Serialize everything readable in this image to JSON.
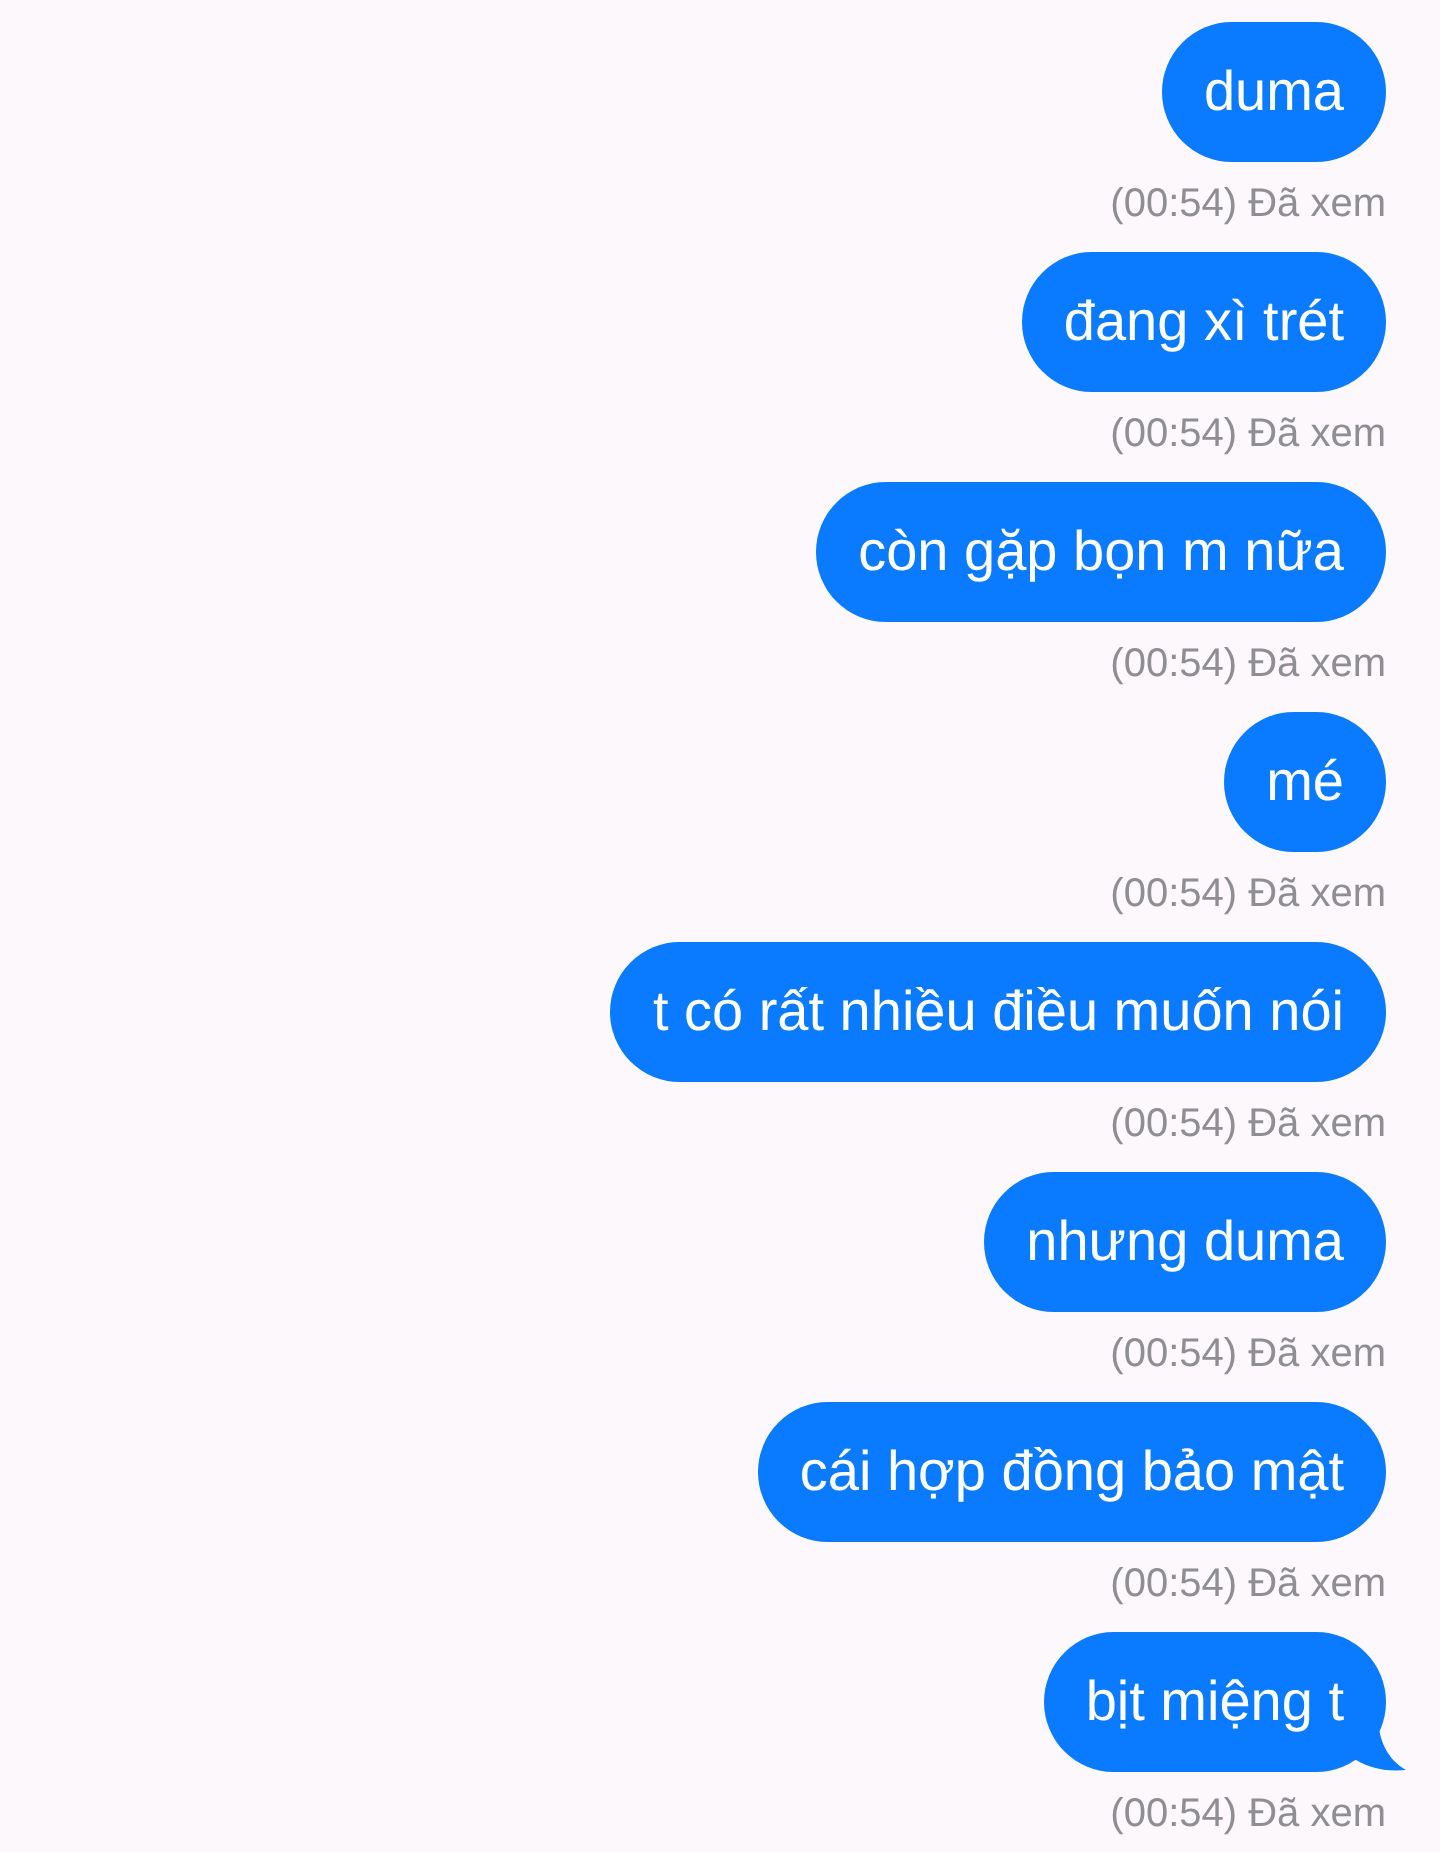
{
  "messages": [
    {
      "text": "duma",
      "status": "(00:54) Đã xem",
      "tail": false
    },
    {
      "text": "đang xì trét",
      "status": "(00:54) Đã xem",
      "tail": false
    },
    {
      "text": "còn gặp bọn m nữa",
      "status": "(00:54) Đã xem",
      "tail": false
    },
    {
      "text": "mé",
      "status": "(00:54) Đã xem",
      "tail": false
    },
    {
      "text": "t có rất nhiều điều muốn nói",
      "status": "(00:54) Đã xem",
      "tail": false
    },
    {
      "text": "nhưng duma",
      "status": "(00:54) Đã xem",
      "tail": false
    },
    {
      "text": "cái hợp đồng bảo mật",
      "status": "(00:54) Đã xem",
      "tail": false
    },
    {
      "text": "bịt miệng t",
      "status": "(00:54) Đã xem",
      "tail": true
    }
  ]
}
